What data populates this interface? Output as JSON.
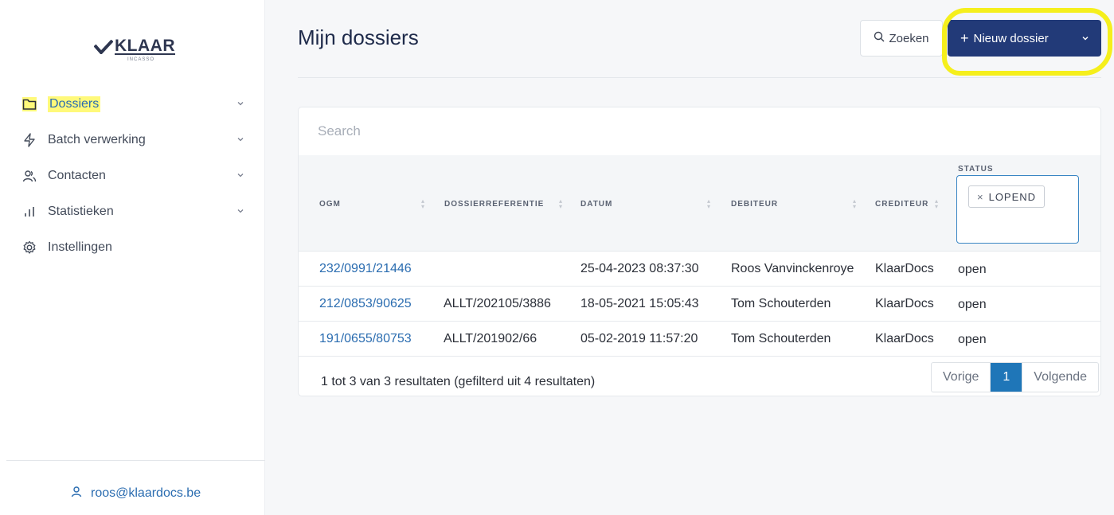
{
  "logo": {
    "word": "KLAAR",
    "sub": "INCASSO"
  },
  "sidebar": {
    "items": [
      {
        "label": "Dossiers",
        "icon": "folder-icon",
        "has_chevron": true,
        "active": true
      },
      {
        "label": "Batch verwerking",
        "icon": "lightning-icon",
        "has_chevron": true
      },
      {
        "label": "Contacten",
        "icon": "users-icon",
        "has_chevron": true
      },
      {
        "label": "Statistieken",
        "icon": "bar-chart-icon",
        "has_chevron": true
      },
      {
        "label": "Instellingen",
        "icon": "gear-icon",
        "has_chevron": false
      }
    ],
    "user_email": "roos@klaardocs.be"
  },
  "header": {
    "title": "Mijn dossiers",
    "search_label": "Zoeken",
    "new_label": "Nieuw dossier",
    "new_prefix": "+"
  },
  "table": {
    "search_placeholder": "Search",
    "columns": [
      "OGM",
      "DOSSIERREFERENTIE",
      "DATUM",
      "DEBITEUR",
      "CREDITEUR",
      "STATUS"
    ],
    "status_filter": "LOPEND",
    "rows": [
      {
        "ogm": "232/0991/21446",
        "ref": "",
        "datum": "25-04-2023 08:37:30",
        "debiteur": "Roos Vanvinckenroye",
        "crediteur": "KlaarDocs",
        "status": "open"
      },
      {
        "ogm": "212/0853/90625",
        "ref": "ALLT/202105/3886",
        "datum": "18-05-2021 15:05:43",
        "debiteur": "Tom Schouterden",
        "crediteur": "KlaarDocs",
        "status": "open"
      },
      {
        "ogm": "191/0655/80753",
        "ref": "ALLT/201902/66",
        "datum": "05-02-2019 11:57:20",
        "debiteur": "Tom Schouterden",
        "crediteur": "KlaarDocs",
        "status": "open"
      }
    ],
    "summary": "1 tot 3 van 3 resultaten (gefilterd uit 4 resultaten)",
    "pager": {
      "prev": "Vorige",
      "current": "1",
      "next": "Volgende"
    }
  },
  "colors": {
    "primary": "#223a78",
    "link": "#2a6cb0",
    "highlight": "#f5ef1c",
    "page_active": "#1f76b8"
  }
}
